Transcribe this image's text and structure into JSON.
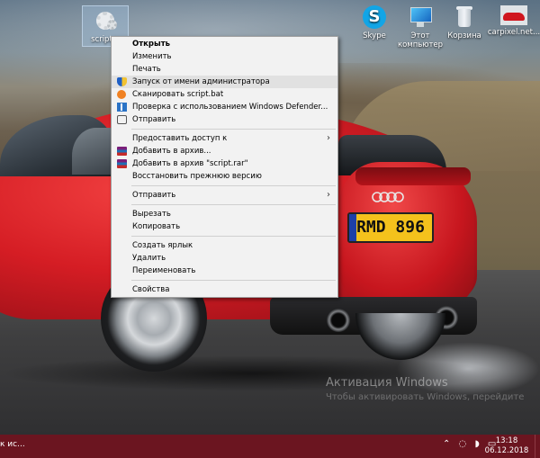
{
  "desktop": {
    "icons": [
      {
        "label": "script..."
      },
      {
        "label": "Skype"
      },
      {
        "label": "Этот компьютер"
      },
      {
        "label": "Корзина"
      },
      {
        "label": "carpixel.net..."
      }
    ],
    "plate_text": "RMD 896",
    "watermark": "Активация Windows",
    "watermark_sub": "Чтобы активировать Windows, перейдите"
  },
  "context_menu": {
    "items": [
      {
        "label": "Открыть"
      },
      {
        "label": "Изменить"
      },
      {
        "label": "Печать"
      },
      {
        "label": "Запуск от имени администратора",
        "icon": "shield-icon"
      },
      {
        "label": "Сканировать script.bat",
        "icon": "avast-icon"
      },
      {
        "label": "Проверка с использованием Windows Defender...",
        "icon": "defender-icon"
      },
      {
        "label": "Отправить",
        "icon": "share-icon"
      },
      {
        "label": "Предоставить доступ к"
      },
      {
        "label": "Добавить в архив...",
        "icon": "winrar-icon"
      },
      {
        "label": "Добавить в архив \"script.rar\"",
        "icon": "winrar-icon"
      },
      {
        "label": "Восстановить прежнюю версию"
      },
      {
        "label": "Отправить"
      },
      {
        "label": "Вырезать"
      },
      {
        "label": "Копировать"
      },
      {
        "label": "Создать ярлык"
      },
      {
        "label": "Удалить"
      },
      {
        "label": "Переименовать"
      },
      {
        "label": "Свойства"
      }
    ],
    "submenu_arrow": "›"
  },
  "taskbar": {
    "search_text": "к ис...",
    "tray_icons": "⌃ ◌ ◗ ▭",
    "time": "13:18",
    "date": "06.12.2018"
  },
  "colors": {
    "taskbar": "#6b1520",
    "menu_bg": "#f2f2f2",
    "menu_highlight": "#e1e1e1"
  }
}
